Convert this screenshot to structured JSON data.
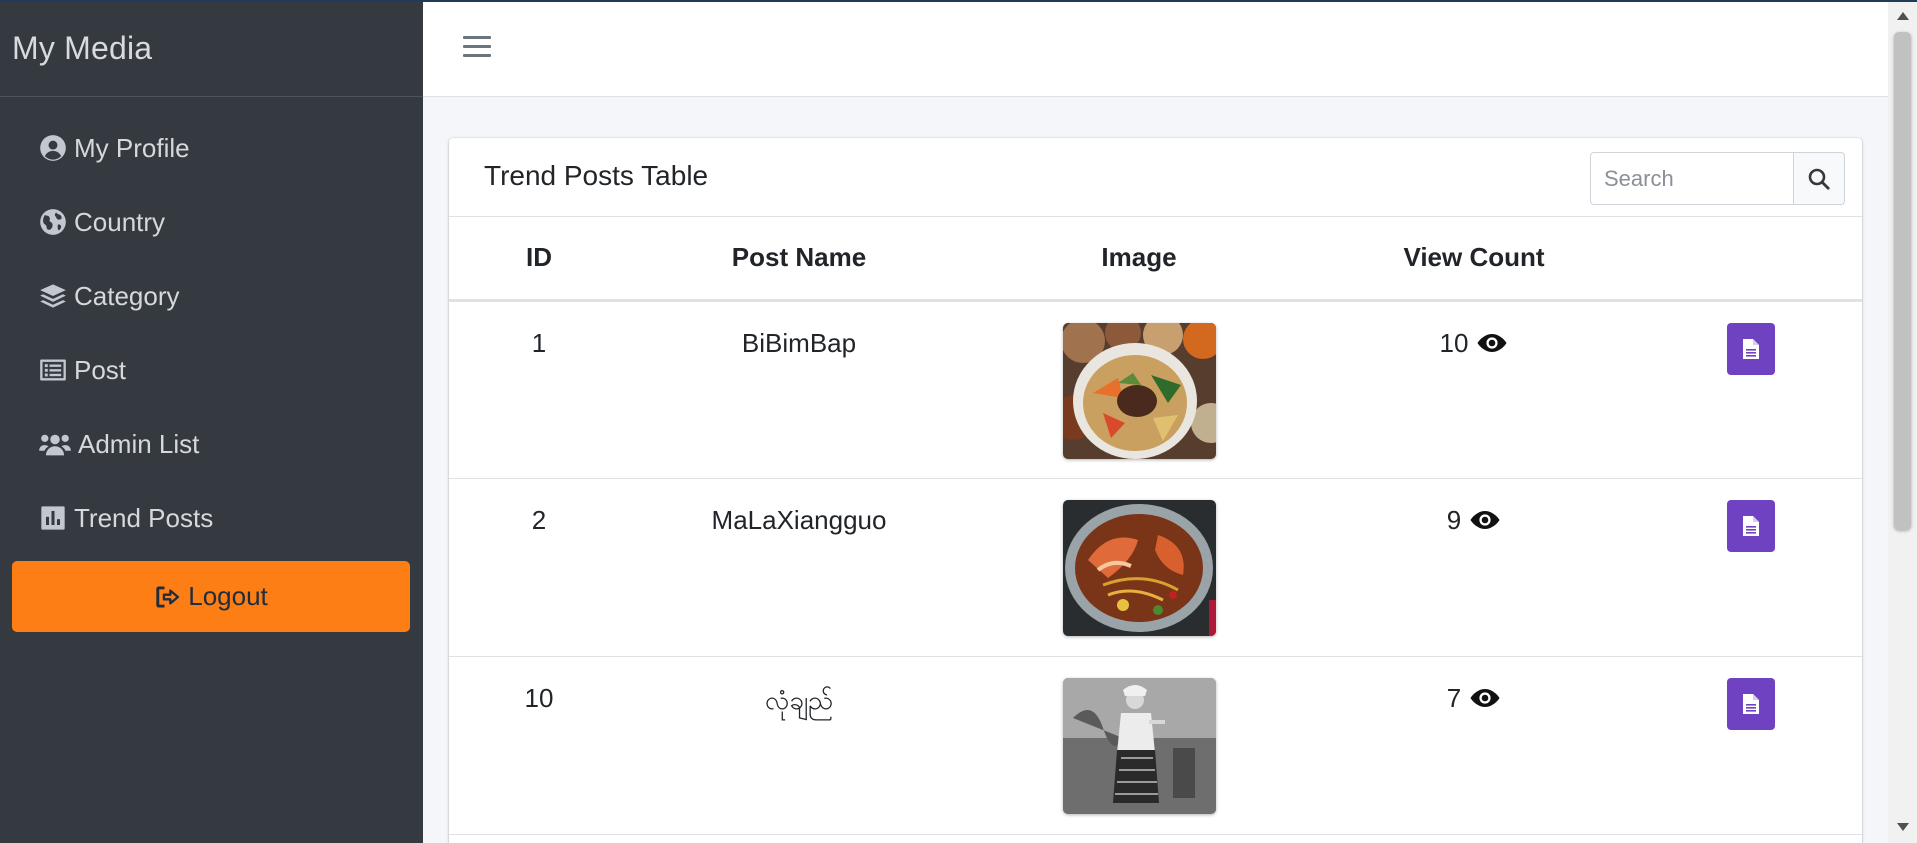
{
  "sidebar": {
    "brand": "My Media",
    "items": [
      {
        "label": "My Profile",
        "icon": "user-circle-icon"
      },
      {
        "label": "Country",
        "icon": "globe-icon"
      },
      {
        "label": "Category",
        "icon": "layers-icon"
      },
      {
        "label": "Post",
        "icon": "list-alt-icon"
      },
      {
        "label": "Admin List",
        "icon": "users-icon"
      },
      {
        "label": "Trend Posts",
        "icon": "chart-bar-icon"
      }
    ],
    "logout_label": "Logout"
  },
  "colors": {
    "sidebar_bg": "#343a40",
    "logout_bg": "#fd7e14",
    "action_button": "#6f42c1"
  },
  "card": {
    "title": "Trend Posts Table",
    "search_placeholder": "Search"
  },
  "table": {
    "headers": [
      "ID",
      "Post Name",
      "Image",
      "View Count",
      ""
    ],
    "rows": [
      {
        "id": "1",
        "name": "BiBimBap",
        "image": "bibimbap-photo",
        "views": "10"
      },
      {
        "id": "2",
        "name": "MaLaXiangguo",
        "image": "malaxiangguo-photo",
        "views": "9"
      },
      {
        "id": "10",
        "name": "လုံချည်",
        "image": "longyi-photo",
        "views": "7"
      }
    ]
  }
}
